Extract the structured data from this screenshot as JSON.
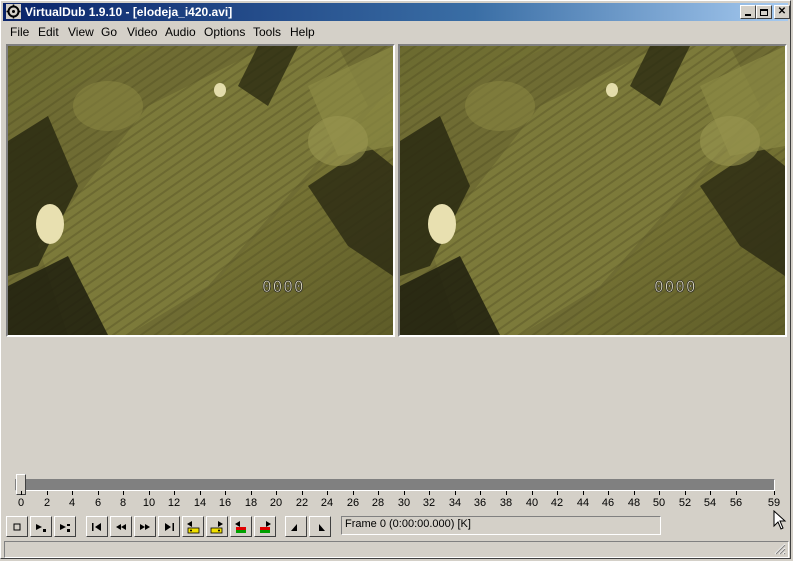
{
  "window": {
    "title": "VirtualDub 1.9.10 - [elodeja_i420.avi]"
  },
  "menu": [
    {
      "label": "File"
    },
    {
      "label": "Edit"
    },
    {
      "label": "View"
    },
    {
      "label": "Go"
    },
    {
      "label": "Video"
    },
    {
      "label": "Audio"
    },
    {
      "label": "Options"
    },
    {
      "label": "Tools"
    },
    {
      "label": "Help"
    }
  ],
  "panes": {
    "input_overlay": "0000",
    "output_overlay": "0000"
  },
  "timeline": {
    "current_frame": 0,
    "max_frame": 59,
    "labels": [
      "0",
      "2",
      "4",
      "6",
      "8",
      "10",
      "12",
      "14",
      "16",
      "18",
      "20",
      "22",
      "24",
      "26",
      "28",
      "30",
      "32",
      "34",
      "36",
      "38",
      "40",
      "42",
      "44",
      "46",
      "48",
      "50",
      "52",
      "54",
      "56",
      "59"
    ]
  },
  "transport": {
    "frame_text": "Frame 0 (0:00:00.000) [K]"
  },
  "icons": {
    "stop": "stop-icon",
    "play_input": "play-input-icon",
    "play_output": "play-output-icon",
    "start": "go-start-icon",
    "prev": "prev-frame-icon",
    "next": "next-frame-icon",
    "end": "go-end-icon",
    "prev_key": "prev-keyframe-icon",
    "next_key": "next-keyframe-icon",
    "prev_scene": "prev-scene-icon",
    "next_scene": "next-scene-icon",
    "mark_in": "mark-in-icon",
    "mark_out": "mark-out-icon"
  },
  "colors": {
    "title_start": "#0a246a",
    "title_end": "#a6caf0",
    "face": "#d4d0c8",
    "key_yellow": "#f0e000",
    "scene_red": "#e00000",
    "scene_green": "#00a000"
  }
}
